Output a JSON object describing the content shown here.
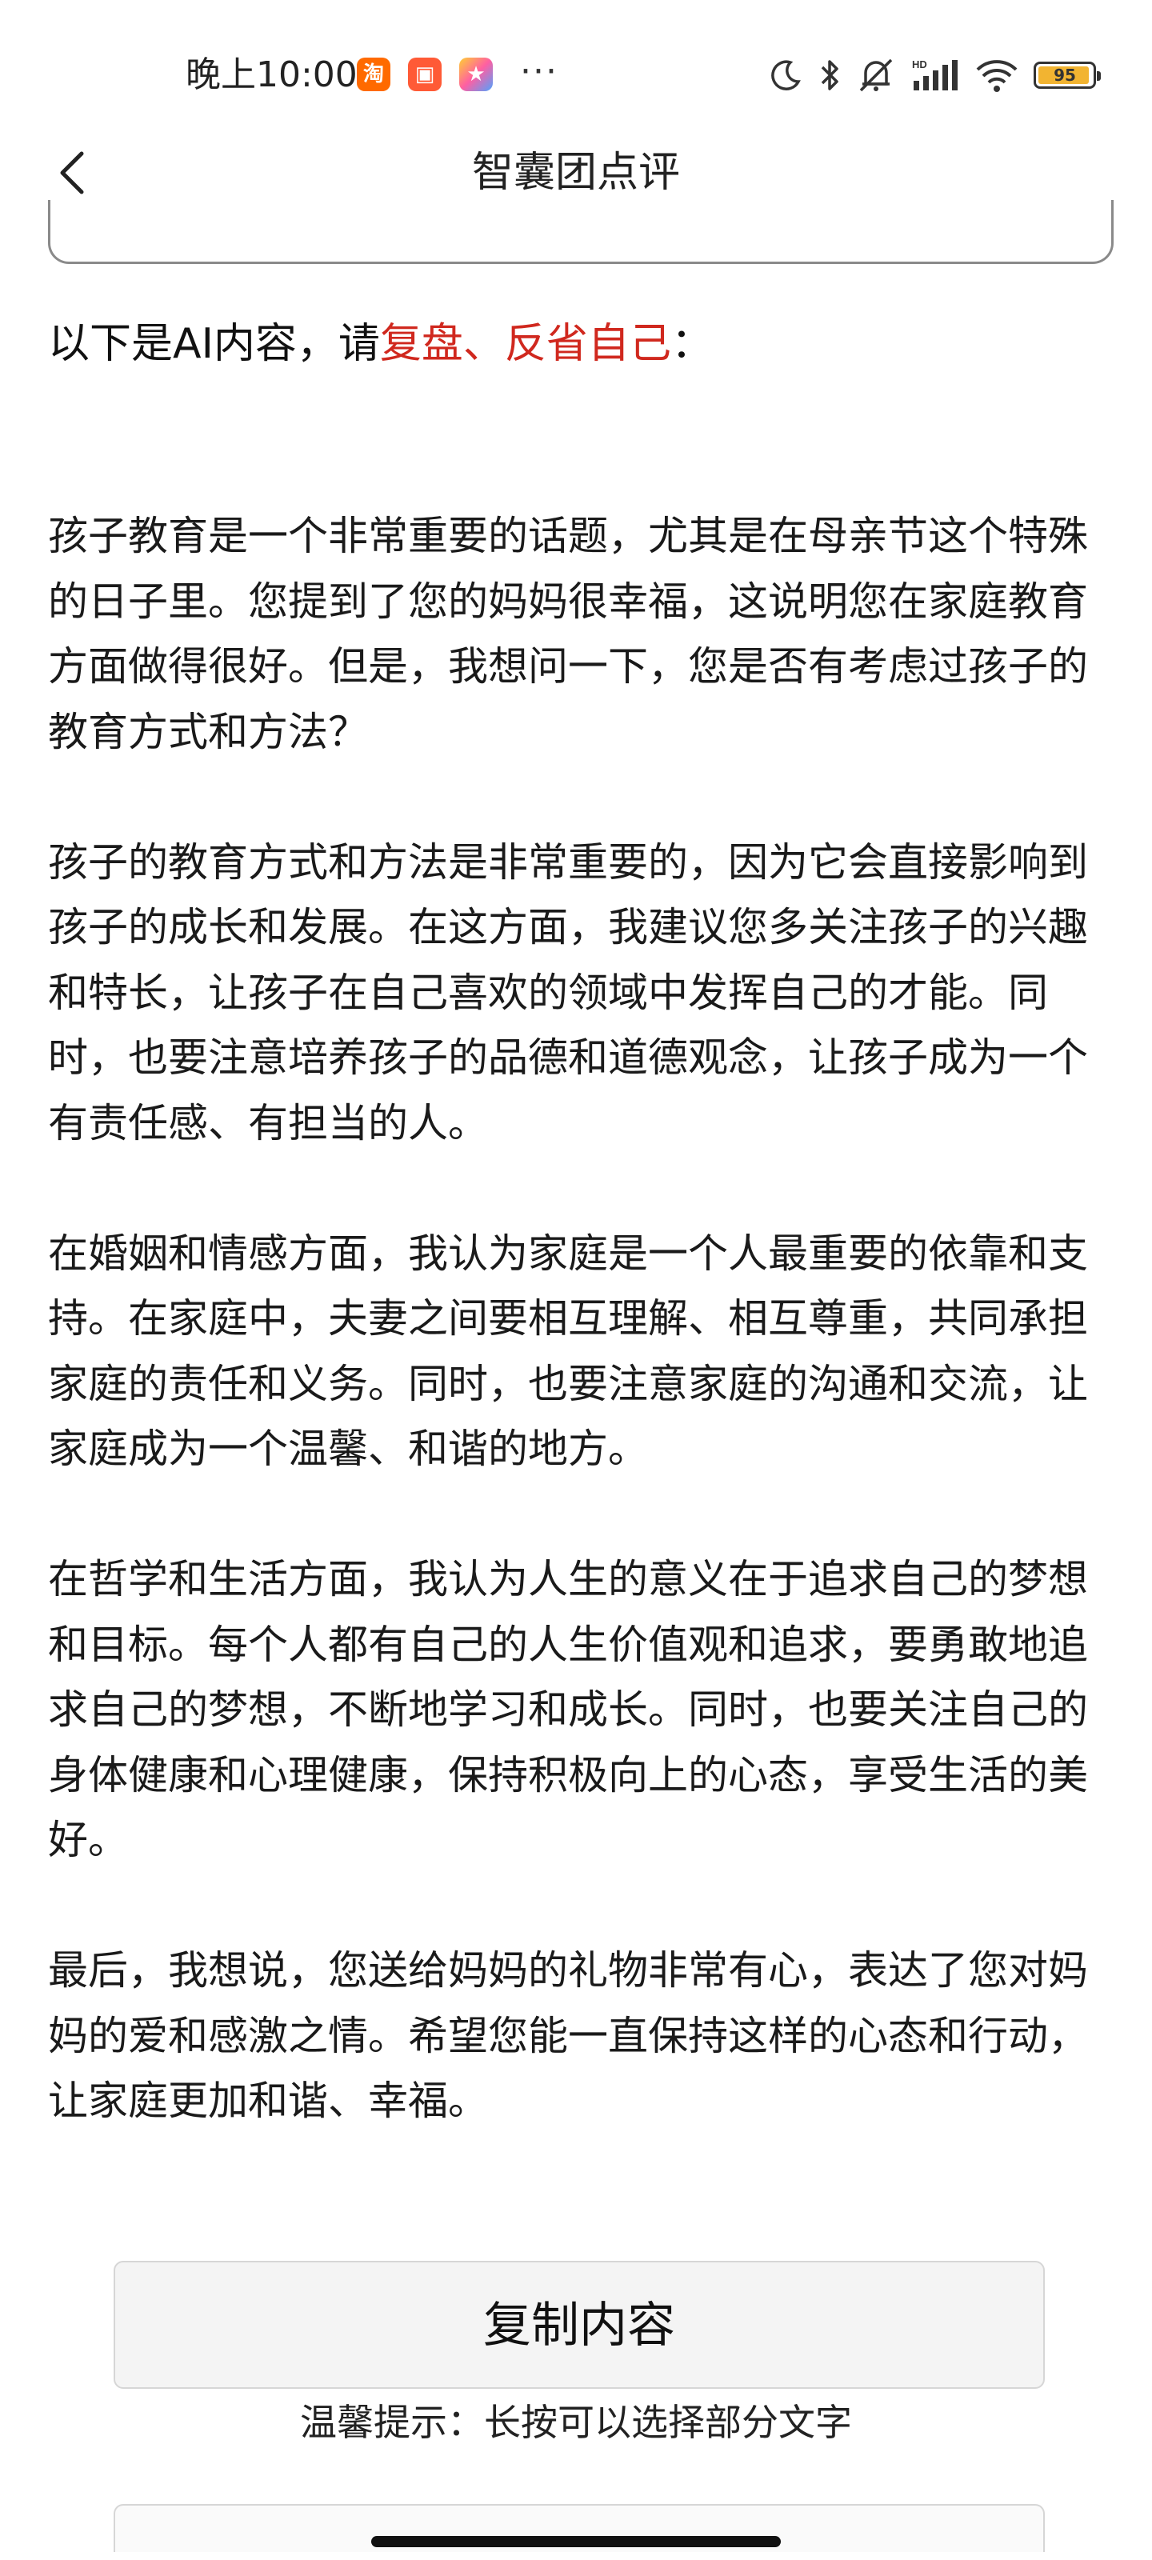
{
  "status_bar": {
    "time": "晚上10:00",
    "notif_icons": [
      "taobao-icon",
      "shopping-icon",
      "star-app-icon"
    ],
    "more": "···",
    "battery_level": "95",
    "battery_fraction": 0.95,
    "battery_color": "#f2b431"
  },
  "header": {
    "title": "智囊团点评"
  },
  "intro": {
    "prefix": "以下是AI内容，请",
    "highlight": "复盘、反省自己",
    "suffix": "：",
    "highlight_color": "#d0281e"
  },
  "paragraphs": [
    "孩子教育是一个非常重要的话题，尤其是在母亲节这个特殊的日子里。您提到了您的妈妈很幸福，这说明您在家庭教育方面做得很好。但是，我想问一下，您是否有考虑过孩子的教育方式和方法？",
    "孩子的教育方式和方法是非常重要的，因为它会直接影响到孩子的成长和发展。在这方面，我建议您多关注孩子的兴趣和特长，让孩子在自己喜欢的领域中发挥自己的才能。同时，也要注意培养孩子的品德和道德观念，让孩子成为一个有责任感、有担当的人。",
    "在婚姻和情感方面，我认为家庭是一个人最重要的依靠和支持。在家庭中，夫妻之间要相互理解、相互尊重，共同承担家庭的责任和义务。同时，也要注意家庭的沟通和交流，让家庭成为一个温馨、和谐的地方。",
    "在哲学和生活方面，我认为人生的意义在于追求自己的梦想和目标。每个人都有自己的人生价值观和追求，要勇敢地追求自己的梦想，不断地学习和成长。同时，也要关注自己的身体健康和心理健康，保持积极向上的心态，享受生活的美好。",
    "最后，我想说，您送给妈妈的礼物非常有心，表达了您对妈妈的爱和感激之情。希望您能一直保持这样的心态和行动，让家庭更加和谐、幸福。"
  ],
  "actions": {
    "copy_label": "复制内容",
    "tip": "温馨提示：长按可以选择部分文字"
  }
}
